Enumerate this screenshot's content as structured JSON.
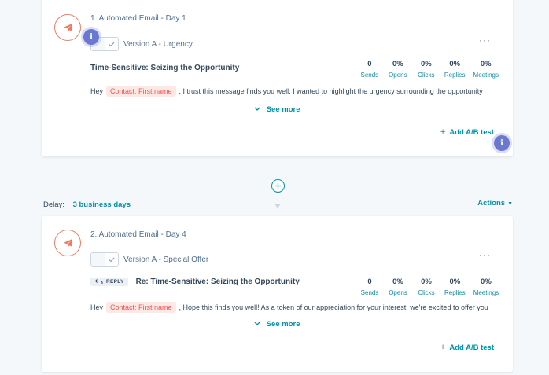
{
  "steps": [
    {
      "title": "1. Automated Email - Day 1",
      "variant": "Version A - Urgency",
      "reply_label": "",
      "subject": "Time-Sensitive: Seizing the Opportunity",
      "preview_before": "Hey",
      "token": "Contact: First name",
      "preview_after": ", I trust this message finds you well. I wanted to highlight the urgency surrounding the opportunity",
      "see_more": "See more",
      "ab_test": "Add A/B test",
      "stats": [
        {
          "value": "0",
          "label": "Sends"
        },
        {
          "value": "0%",
          "label": "Opens"
        },
        {
          "value": "0%",
          "label": "Clicks"
        },
        {
          "value": "0%",
          "label": "Replies"
        },
        {
          "value": "0%",
          "label": "Meetings"
        }
      ]
    },
    {
      "title": "2. Automated Email - Day 4",
      "variant": "Version A - Special Offer",
      "reply_label": "REPLY",
      "subject": "Re: Time-Sensitive: Seizing the Opportunity",
      "preview_before": "Hey",
      "token": "Contact: First name",
      "preview_after": ", Hope this finds you well! As a token of our appreciation for your interest, we're excited to offer you",
      "see_more": "See more",
      "ab_test": "Add A/B test",
      "stats": [
        {
          "value": "0",
          "label": "Sends"
        },
        {
          "value": "0%",
          "label": "Opens"
        },
        {
          "value": "0%",
          "label": "Clicks"
        },
        {
          "value": "0%",
          "label": "Replies"
        },
        {
          "value": "0%",
          "label": "Meetings"
        }
      ]
    }
  ],
  "delay": {
    "label": "Delay:",
    "value": "3 business days"
  },
  "actions_label": "Actions",
  "info_badge": "i",
  "more_menu": "···",
  "icons": {
    "step": "paper-plane-icon",
    "info": "info-icon",
    "toggle": "check-icon",
    "reply": "reply-arrow-icon",
    "expand": "chevron-down-icon",
    "add": "plus-icon"
  },
  "colors": {
    "accent": "#0091ae",
    "coral": "#f2795f",
    "token_bg": "#fde8e3",
    "info": "#6a78d1",
    "text": "#33475b"
  }
}
